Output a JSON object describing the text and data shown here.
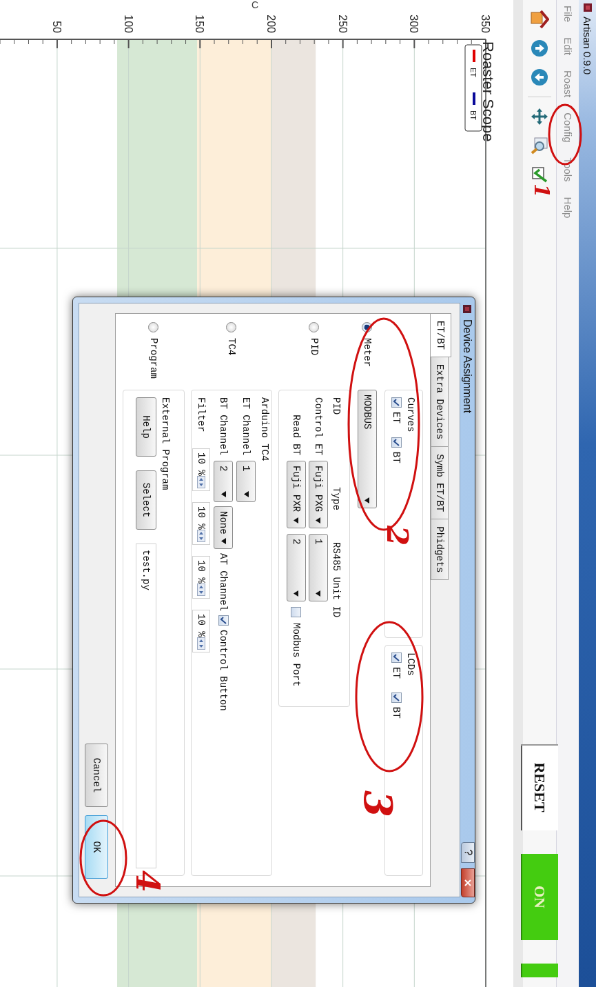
{
  "window": {
    "title": "Artisan 0.9.0"
  },
  "menu": [
    "File",
    "Edit",
    "Roast",
    "Config",
    "Tools",
    "Help"
  ],
  "control_buttons": [
    {
      "label": "RESET",
      "kind": "plain"
    },
    {
      "label": "ON",
      "kind": "green"
    },
    {
      "kind": "green"
    }
  ],
  "chart": {
    "title": "Roaster Scope",
    "axis_title": "C",
    "axis_labels": [
      "50",
      "100",
      "150",
      "200",
      "250",
      "300",
      "350"
    ],
    "legend": [
      {
        "label": "ET",
        "color": "#e00000"
      },
      {
        "label": "BT",
        "color": "#0a0a9a"
      }
    ]
  },
  "dialog": {
    "title": "Device Assignment",
    "tabs": [
      {
        "label": "ET/BT",
        "selected": true
      },
      {
        "label": "Extra Devices",
        "selected": false
      },
      {
        "label": "Symb ET/BT",
        "selected": false
      },
      {
        "label": "Phidgets",
        "selected": false
      }
    ],
    "devices": [
      {
        "label": "Meter",
        "selected": true
      },
      {
        "label": "PID",
        "selected": false
      },
      {
        "label": "TC4",
        "selected": false
      },
      {
        "label": "Program",
        "selected": false
      }
    ],
    "curves": {
      "title": "Curves",
      "items": [
        {
          "label": "ET",
          "checked": true
        },
        {
          "label": "BT",
          "checked": true
        }
      ]
    },
    "lcds": {
      "title": "LCDs",
      "items": [
        {
          "label": "ET",
          "checked": true
        },
        {
          "label": "BT",
          "checked": true
        }
      ]
    },
    "meter_type": "MODBUS",
    "pid": {
      "title": "PID",
      "type_header": "Type",
      "unit_header": "RS485 Unit ID",
      "rows": [
        {
          "label": "Control ET",
          "type": "Fuji PXG",
          "unit": "1"
        },
        {
          "label": "Read BT",
          "type": "Fuji PXR",
          "unit": "2"
        }
      ],
      "modbus_port": {
        "label": "Modbus Port",
        "checked": false
      }
    },
    "tc4": {
      "title": "Arduino TC4",
      "et_channel": {
        "label": "ET Channel",
        "value": "1"
      },
      "bt_channel": {
        "label": "BT Channel",
        "value": "2"
      },
      "at_channel": {
        "label": "AT Channel",
        "value": "None"
      },
      "control_button": {
        "label": "Control Button",
        "checked": true
      },
      "filter": {
        "label": "Filter",
        "values": [
          "10 %",
          "10 %",
          "10 %",
          "10 %"
        ]
      }
    },
    "external": {
      "title": "External Program",
      "buttons": [
        "Help",
        "Select"
      ],
      "path": "test.py"
    },
    "buttons": [
      {
        "label": "Cancel",
        "default": false
      },
      {
        "label": "OK",
        "default": true
      }
    ]
  },
  "annotations": [
    {
      "kind": "ellipse"
    },
    {
      "kind": "number",
      "label": "1"
    },
    {
      "kind": "ellipse"
    },
    {
      "kind": "number",
      "label": "2"
    },
    {
      "kind": "ellipse"
    },
    {
      "kind": "number",
      "label": "3"
    },
    {
      "kind": "ellipse"
    },
    {
      "kind": "number",
      "label": "4"
    }
  ]
}
